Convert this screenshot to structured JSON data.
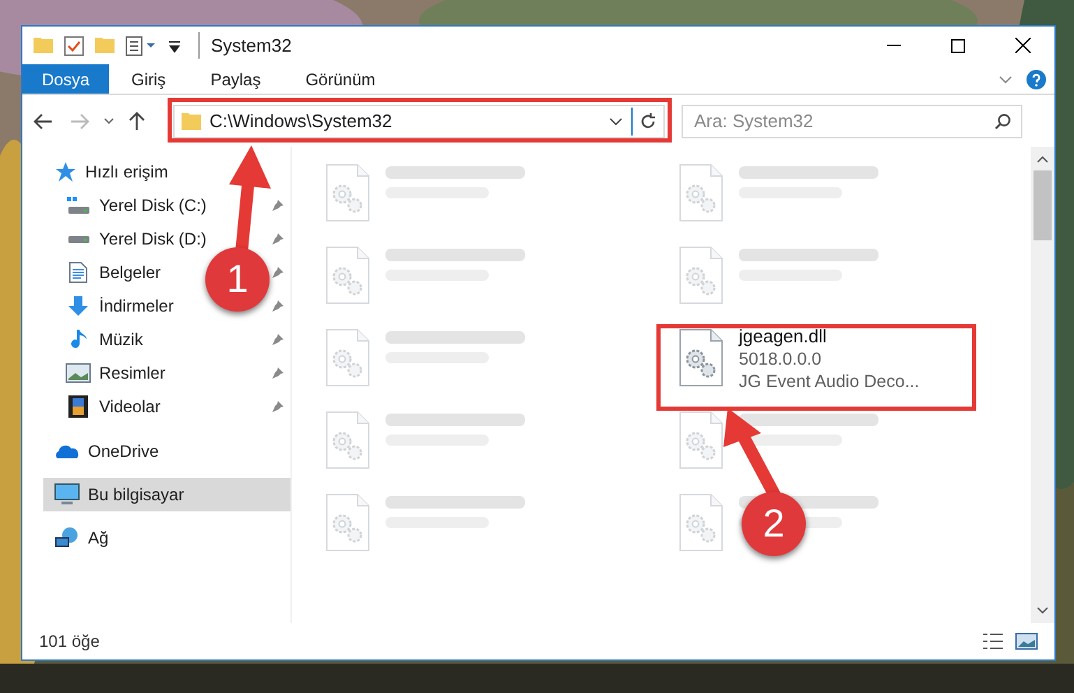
{
  "window": {
    "title": "System32"
  },
  "ribbon_tabs": [
    {
      "label": "Dosya",
      "selected": true
    },
    {
      "label": "Giriş",
      "selected": false
    },
    {
      "label": "Paylaş",
      "selected": false
    },
    {
      "label": "Görünüm",
      "selected": false
    }
  ],
  "address": {
    "path": "C:\\Windows\\System32"
  },
  "search": {
    "placeholder": "Ara: System32"
  },
  "sidebar": {
    "items": [
      {
        "label": "Hızlı erişim",
        "selected": false,
        "children": [
          {
            "label": "Yerel Disk (C:)",
            "pinned": true
          },
          {
            "label": "Yerel Disk (D:)",
            "pinned": true
          },
          {
            "label": "Belgeler",
            "pinned": true
          },
          {
            "label": "İndirmeler",
            "pinned": true
          },
          {
            "label": "Müzik",
            "pinned": true
          },
          {
            "label": "Resimler",
            "pinned": true
          },
          {
            "label": "Videolar",
            "pinned": true
          }
        ]
      },
      {
        "label": "OneDrive",
        "selected": false
      },
      {
        "label": "Bu bilgisayar",
        "selected": true
      },
      {
        "label": "Ağ",
        "selected": false
      }
    ]
  },
  "files": [
    {
      "blurred": true
    },
    {
      "blurred": true
    },
    {
      "blurred": true
    },
    {
      "blurred": true
    },
    {
      "blurred": true
    },
    {
      "name": "jgeagen.dll",
      "lines": [
        "5018.0.0.0",
        "JG Event Audio Deco..."
      ],
      "blurred": false
    },
    {
      "blurred": true
    },
    {
      "blurred": true
    },
    {
      "blurred": true
    },
    {
      "blurred": true
    }
  ],
  "status_bar": {
    "count": "101 öğe"
  },
  "annotations": [
    {
      "number": "1"
    },
    {
      "number": "2"
    }
  ]
}
